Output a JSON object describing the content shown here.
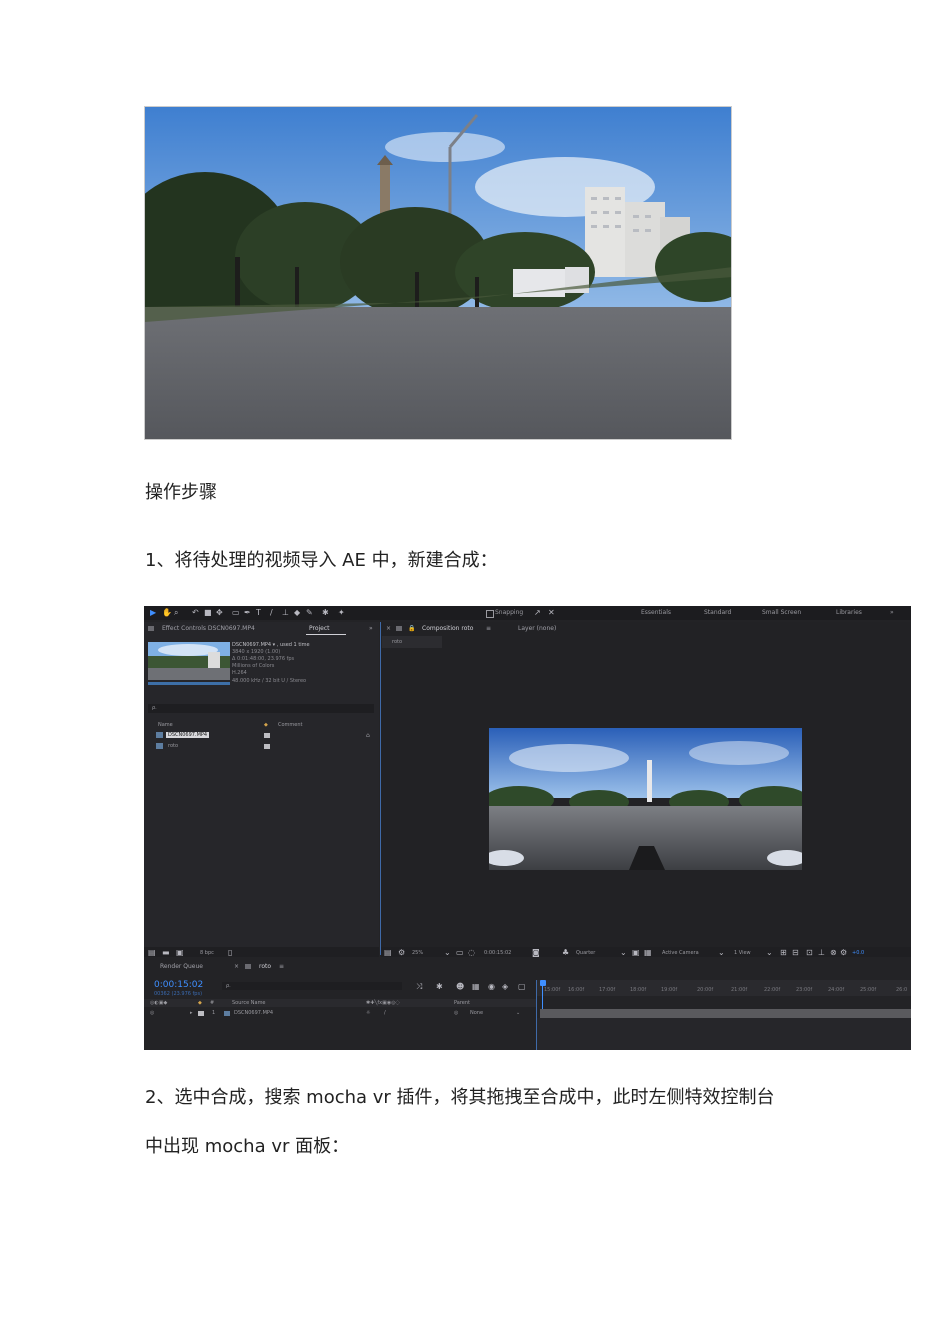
{
  "doc": {
    "heading": "操作步骤",
    "step1": "1、将待处理的视频导入 AE 中，新建合成：",
    "step2_line1": "2、选中合成，搜索 mocha vr 插件，将其拖拽至合成中，此时左侧特效控制台",
    "step2_line2": "中出现 mocha vr 面板："
  },
  "ae": {
    "toolbar": {
      "snapping": "Snapping",
      "workspaces": [
        "Essentials",
        "Standard",
        "Small Screen",
        "Libraries"
      ],
      "more": "»"
    },
    "left_panel": {
      "tab_effect_controls": "Effect Controls DSCN0697.MP4",
      "tab_project": "Project",
      "file_name": "DSCN0697.MP4 ▾ , used 1 time",
      "file_meta": [
        "3840 x 1920 (1.00)",
        "Δ 0:01:48:00, 23.976 fps",
        "Millions of Colors",
        "H.264",
        "48.000 kHz / 32 bit U / Stereo"
      ],
      "search_placeholder": "ρ.",
      "col_name": "Name",
      "col_comment": "Comment",
      "items": [
        "DSCN0697.MP4",
        "roto"
      ],
      "bpc": "8 bpc"
    },
    "comp_panel": {
      "tab_comp": "Composition roto",
      "tab_layer": "Layer (none)",
      "crumb": "roto",
      "zoom": "25%",
      "timecode": "0:00:15:02",
      "resolution": "Quarter",
      "camera": "Active Camera",
      "views": "1 View",
      "exposure": "+0.0"
    },
    "timeline": {
      "render_queue": "Render Queue",
      "comp_tab": "roto",
      "timecode": "0:00:15:02",
      "frame_info": "00362 (23.976 fps)",
      "col_source": "Source Name",
      "col_parent": "Parent",
      "layer_num": "1",
      "layer_name": "DSCN0697.MP4",
      "parent_value": "None",
      "ruler": [
        "15:00f",
        "16:00f",
        "17:00f",
        "18:00f",
        "19:00f",
        "20:00f",
        "21:00f",
        "22:00f",
        "23:00f",
        "24:00f",
        "25:00f",
        "26:0"
      ]
    }
  }
}
